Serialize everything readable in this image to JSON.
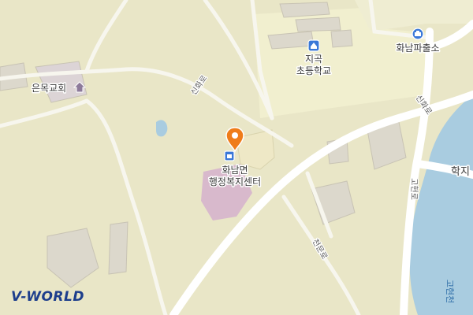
{
  "map": {
    "colors": {
      "land": "#e9e6c7",
      "school_area": "#f1efcf",
      "facility_area": "#d8b9cc",
      "building": "#dcd8cc",
      "water": "#a9cce0",
      "road_major": "#ffffff",
      "road_minor": "#f7f6ee",
      "marker_orange": "#ef7c1a",
      "poi_blue": "#3a78d8"
    },
    "places": {
      "church": "은목교회",
      "school_line1": "지곡",
      "school_line2": "초등학교",
      "police": "화남파출소",
      "office_line1": "화남면",
      "office_line2": "행정복지센터"
    },
    "roads": {
      "sinhwa_1": "신화로",
      "sinhwa_2": "신화로",
      "cheonmun": "천문로",
      "goheon": "고헌로",
      "right_cut": "학지"
    },
    "water_label": "고현천",
    "icons": {
      "church": "church-icon",
      "school": "school-icon",
      "police": "police-icon",
      "office": "government-office-icon",
      "marker": "location-pin-icon"
    },
    "logo": "V-WORLD"
  }
}
